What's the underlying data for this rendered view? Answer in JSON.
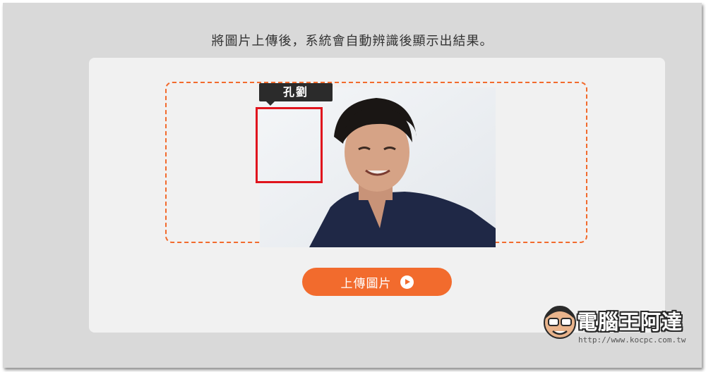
{
  "instruction": "將圖片上傳後，系統會自動辨識後顯示出結果。",
  "result": {
    "face_label": "孔劉"
  },
  "upload_button": {
    "label": "上傳圖片",
    "icon": "play-circle-icon"
  },
  "watermark": {
    "title": "電腦王阿達",
    "url": "http://www.kocpc.com.tw"
  },
  "colors": {
    "accent": "#f26b2d",
    "face_box": "#e0141d",
    "label_bg": "#2b2b2b",
    "background": "#d9d9d9",
    "card": "#f1f1f1"
  }
}
